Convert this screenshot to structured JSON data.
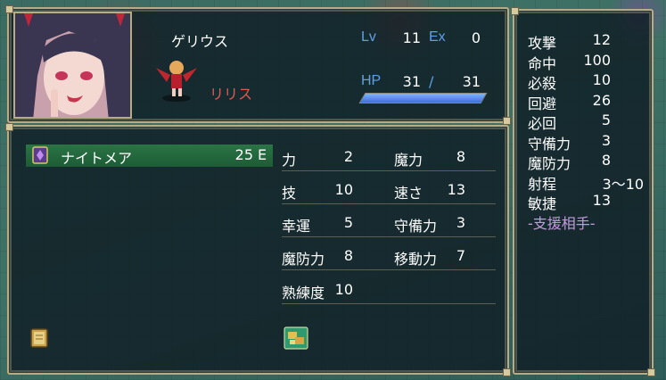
{
  "character": {
    "name": "ゲリウス",
    "lv_label": "Lv",
    "lv": "11",
    "ex_label": "Ex",
    "ex": "0",
    "hp_label": "HP",
    "hp_current": "31",
    "hp_sep": "/",
    "hp_max": "31",
    "hp_fraction": 1.0
  },
  "class_name": "リリス",
  "equipment": {
    "name": "ナイトメア",
    "uses": "25",
    "rank": "E",
    "highlight_color": "#2a7545"
  },
  "stats_left": [
    {
      "label": "力",
      "value": "2"
    },
    {
      "label": "技",
      "value": "10"
    },
    {
      "label": "幸運",
      "value": "5"
    },
    {
      "label": "魔防力",
      "value": "8"
    },
    {
      "label": "熟練度",
      "value": "10"
    }
  ],
  "stats_right": [
    {
      "label": "魔力",
      "value": "8"
    },
    {
      "label": "速さ",
      "value": "13"
    },
    {
      "label": "守備力",
      "value": "3"
    },
    {
      "label": "移動力",
      "value": "7"
    }
  ],
  "battle_stats": [
    {
      "label": "攻撃",
      "value": "12"
    },
    {
      "label": "命中",
      "value": "100"
    },
    {
      "label": "必殺",
      "value": "10"
    },
    {
      "label": "回避",
      "value": "26"
    },
    {
      "label": "必回",
      "value": "5"
    },
    {
      "label": "守備力",
      "value": "3"
    },
    {
      "label": "魔防力",
      "value": "8"
    },
    {
      "label": "射程",
      "value": "3〜10"
    },
    {
      "label": "敏捷",
      "value": "13"
    }
  ],
  "support_heading": "-支援相手-",
  "colors": {
    "frame": "#b8ac86",
    "window_bg": "#10202a",
    "blue_label": "#5f9fe8",
    "class_red": "#e2584f",
    "support_purple": "#c39bdc",
    "hp_fill": "#4f86e8"
  },
  "icons": {
    "equip_item": "spellbook-icon",
    "bottom_left": "book-icon",
    "bottom_center": "item-bag-icon"
  }
}
